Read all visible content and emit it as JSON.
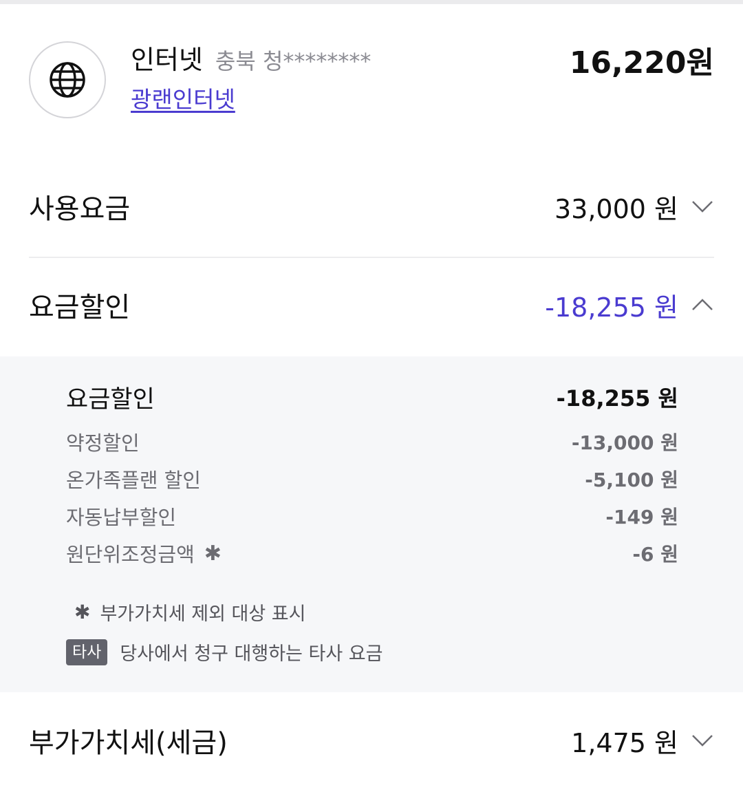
{
  "service": {
    "icon": "globe-icon",
    "name": "인터넷",
    "region": "충북 청********",
    "plan_link": "광랜인터넷",
    "amount": "16,220원"
  },
  "summary": {
    "usage": {
      "label": "사용요금",
      "value": "33,000 원",
      "expanded": false
    },
    "discount": {
      "label": "요금할인",
      "value": "-18,255 원",
      "expanded": true
    },
    "vat": {
      "label": "부가가치세(세금)",
      "value": "1,475 원",
      "expanded": false
    }
  },
  "discount_detail": {
    "header": {
      "label": "요금할인",
      "value": "-18,255 원"
    },
    "items": [
      {
        "label": "약정할인",
        "value": "-13,000 원",
        "mark": ""
      },
      {
        "label": "온가족플랜 할인",
        "value": "-5,100 원",
        "mark": ""
      },
      {
        "label": "자동납부할인",
        "value": "-149 원",
        "mark": ""
      },
      {
        "label": "원단위조정금액",
        "value": "-6 원",
        "mark": "✱"
      }
    ],
    "notes": {
      "vat_exempt": {
        "mark": "✱",
        "text": "부가가치세 제외 대상 표시"
      },
      "third_party": {
        "badge": "타사",
        "text": "당사에서 청구 대행하는 타사 요금"
      }
    }
  },
  "colors": {
    "accent": "#4a3bd0",
    "detail_bg": "#f6f7f9",
    "muted_text": "#6c6c72",
    "badge_bg": "#62636c"
  }
}
